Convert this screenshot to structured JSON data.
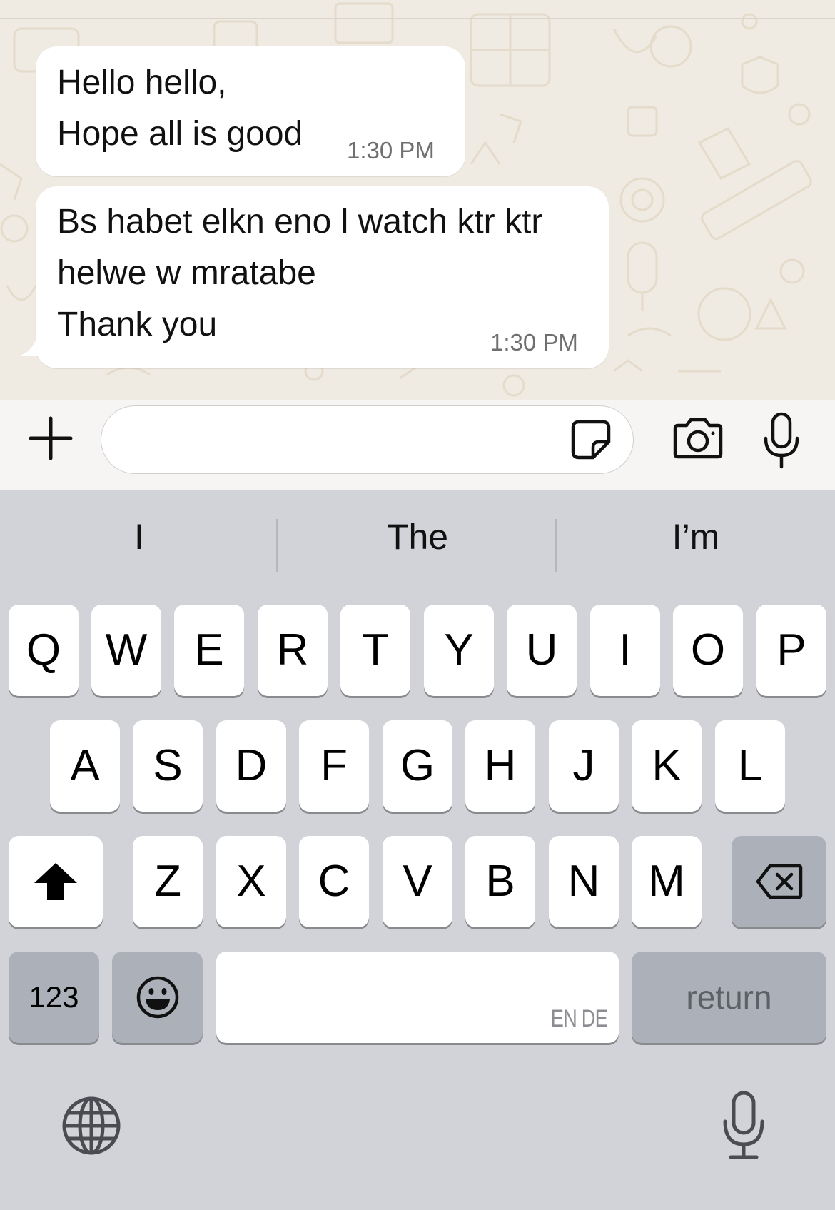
{
  "messages": [
    {
      "lines": [
        "Hello hello,",
        "Hope all is good"
      ],
      "time": "1:30 PM"
    },
    {
      "lines": [
        "Bs habet elkn eno l watch ktr ktr",
        "helwe w mratabe",
        "Thank you"
      ],
      "time": "1:30 PM"
    }
  ],
  "input": {
    "value": "",
    "placeholder": ""
  },
  "input_bar_icons": [
    "plus-icon",
    "sticker-icon",
    "camera-icon",
    "microphone-icon"
  ],
  "keyboard": {
    "suggestions": [
      "I",
      "The",
      "I’m"
    ],
    "row1": [
      "Q",
      "W",
      "E",
      "R",
      "T",
      "Y",
      "U",
      "I",
      "O",
      "P"
    ],
    "row2": [
      "A",
      "S",
      "D",
      "F",
      "G",
      "H",
      "J",
      "K",
      "L"
    ],
    "row3": [
      "Z",
      "X",
      "C",
      "V",
      "B",
      "N",
      "M"
    ],
    "numbers_label": "123",
    "return_label": "return",
    "space_language_hint": "EN DE",
    "icons": [
      "shift-icon",
      "delete-icon",
      "emoji-icon",
      "globe-icon",
      "dictation-icon"
    ]
  },
  "colors": {
    "chat_background": "#efeae2",
    "bubble": "#ffffff",
    "keyboard_background": "#d1d3d9",
    "key": "#ffffff",
    "special_key": "#acb0b9"
  }
}
